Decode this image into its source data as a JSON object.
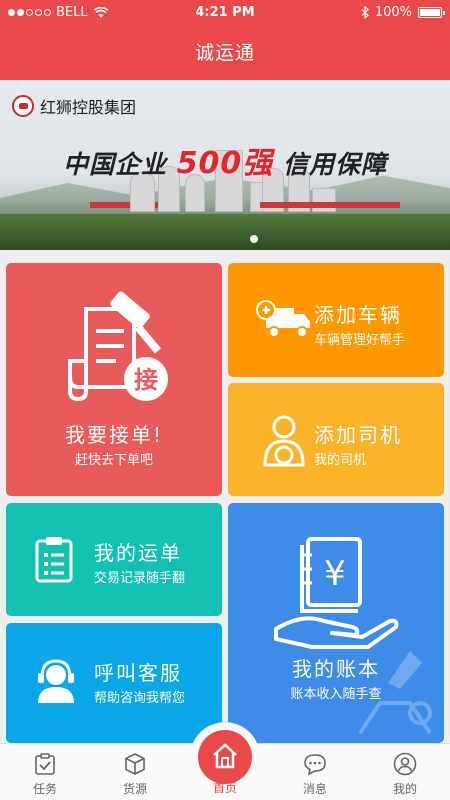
{
  "status_bar": {
    "carrier": "BELL",
    "time": "4:21 PM",
    "battery": "100%"
  },
  "header": {
    "title": "诚运通"
  },
  "banner": {
    "company": "红狮控股集团",
    "slogan_part1": "中国企业",
    "slogan_highlight": "500强",
    "slogan_part2": "信用保障"
  },
  "tiles": {
    "accept_order": {
      "title": "我要接单!",
      "subtitle": "赶快去下单吧",
      "badge": "接"
    },
    "add_vehicle": {
      "title": "添加车辆",
      "subtitle": "车辆管理好帮手"
    },
    "add_driver": {
      "title": "添加司机",
      "subtitle": "我的司机"
    },
    "my_waybill": {
      "title": "我的运单",
      "subtitle": "交易记录随手翻"
    },
    "call_service": {
      "title": "呼叫客服",
      "subtitle": "帮助咨询我帮您"
    },
    "my_ledger": {
      "title": "我的账本",
      "subtitle": "账本收入随手查",
      "symbol": "¥"
    }
  },
  "nav": {
    "items": [
      {
        "label": "任务",
        "icon": "clipboard-check-icon"
      },
      {
        "label": "货源",
        "icon": "box-icon"
      },
      {
        "label": "首页",
        "icon": "home-icon"
      },
      {
        "label": "消息",
        "icon": "chat-bubble-icon"
      },
      {
        "label": "我的",
        "icon": "user-icon"
      }
    ]
  },
  "colors": {
    "primary": "#e94949",
    "tile_accept": "#e95b5b",
    "tile_vehicle": "#ff9800",
    "tile_driver": "#fbb32a",
    "tile_waybill": "#12c1b1",
    "tile_service": "#0aa7e8",
    "tile_ledger": "#3f8be8"
  }
}
